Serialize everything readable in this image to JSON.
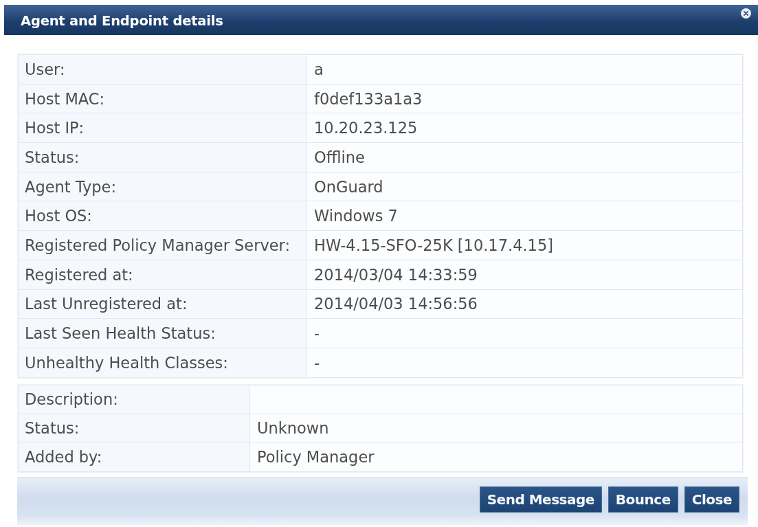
{
  "dialog": {
    "title": "Agent and Endpoint details"
  },
  "agent_details": [
    {
      "label": "User:",
      "value": "a"
    },
    {
      "label": "Host MAC:",
      "value": "f0def133a1a3"
    },
    {
      "label": "Host IP:",
      "value": "10.20.23.125"
    },
    {
      "label": "Status:",
      "value": "Offline"
    },
    {
      "label": "Agent Type:",
      "value": "OnGuard"
    },
    {
      "label": "Host OS:",
      "value": "Windows 7"
    },
    {
      "label": "Registered Policy Manager Server:",
      "value": "HW-4.15-SFO-25K [10.17.4.15]"
    },
    {
      "label": "Registered at:",
      "value": "2014/03/04 14:33:59"
    },
    {
      "label": "Last Unregistered at:",
      "value": "2014/04/03 14:56:56"
    },
    {
      "label": "Last Seen Health Status:",
      "value": "-"
    },
    {
      "label": "Unhealthy Health Classes:",
      "value": "-"
    }
  ],
  "endpoint_details": [
    {
      "label": "Description:"
    },
    {
      "label": "Status:",
      "value": "Unknown"
    },
    {
      "label": "Added by:",
      "value": "Policy Manager"
    }
  ],
  "buttons": [
    "Send Message",
    "Bounce",
    "Close"
  ]
}
